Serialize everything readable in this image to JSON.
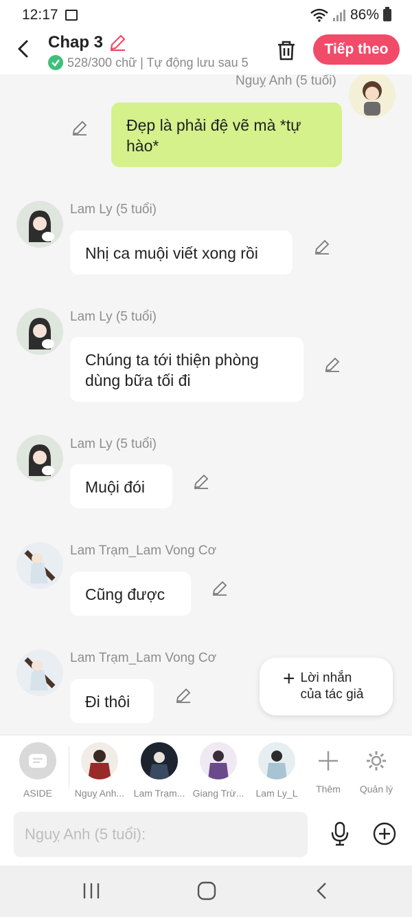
{
  "status_bar": {
    "time": "12:17",
    "battery": "86%"
  },
  "header": {
    "title": "Chap 3",
    "subtitle": "528/300 chữ | Tự động lưu sau 5",
    "next_label": "Tiếp theo"
  },
  "messages": [
    {
      "name": "Nguỵ Anh (5 tuổi)",
      "text": "Đẹp là phải đệ vẽ mà *tự hào*",
      "side": "right",
      "color": "#d4f18b"
    },
    {
      "name": "Lam Ly (5 tuổi)",
      "text": "Nhị ca muội viết xong rồi",
      "side": "left"
    },
    {
      "name": "Lam Ly (5 tuổi)",
      "text": "Chúng ta tới thiện phòng dùng bữa tối đi",
      "side": "left"
    },
    {
      "name": "Lam Ly (5 tuổi)",
      "text": "Muội đói",
      "side": "left"
    },
    {
      "name": "Lam Trạm_Lam Vong Cơ",
      "text": "Cũng được",
      "side": "left"
    },
    {
      "name": "Lam Trạm_Lam Vong Cơ",
      "text": "Đi thôi",
      "side": "left"
    }
  ],
  "fab": {
    "label": "Lời nhắn của tác giả"
  },
  "characters": [
    {
      "label": "ASIDE"
    },
    {
      "label": "Nguỵ Anh..."
    },
    {
      "label": "Lam Trạm..."
    },
    {
      "label": "Giang Trừ..."
    },
    {
      "label": "Lam Ly_L"
    },
    {
      "label": "Thêm"
    },
    {
      "label": "Quản lý"
    }
  ],
  "input": {
    "placeholder": "Nguỵ Anh (5 tuổi):"
  },
  "colors": {
    "accent": "#f24a69",
    "green_bubble": "#d4f18b",
    "check": "#3ec07b"
  }
}
